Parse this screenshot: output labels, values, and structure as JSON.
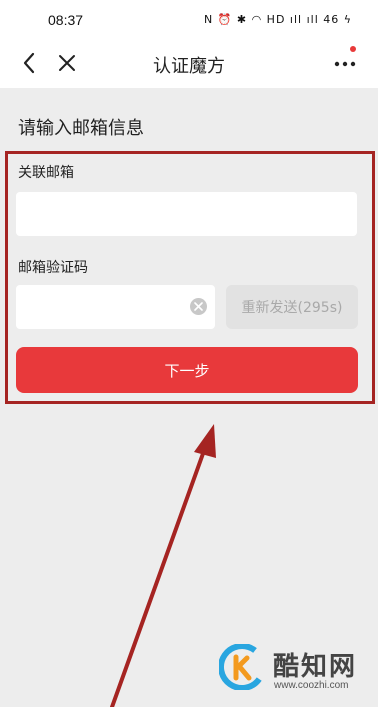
{
  "status_bar": {
    "time": "08:37",
    "icons_text": "N ⏰ ✱ ◠ HD ıll ıll 46 ϟ",
    "icons": [
      "nfc-icon",
      "alarm-icon",
      "bluetooth-icon",
      "wifi-icon",
      "hd-icon",
      "signal-icon",
      "signal-icon",
      "battery-icon",
      "charging-icon"
    ],
    "battery_level": "46"
  },
  "nav": {
    "title": "认证魔方",
    "back_icon": "back-chevron-icon",
    "close_icon": "close-icon",
    "more_icon": "more-dots-icon",
    "notification_dot_color": "#e83a3a"
  },
  "form": {
    "section_title": "请输入邮箱信息",
    "email_label": "关联邮箱",
    "email_value": "",
    "code_label": "邮箱验证码",
    "code_value": "",
    "resend_label": "重新发送(295s)",
    "next_label": "下一步"
  },
  "colors": {
    "accent": "#e8393b",
    "annotation": "#a52422",
    "background": "#ededed",
    "resend_disabled_bg": "#e2e2e2",
    "resend_disabled_text": "#a9a9a9"
  },
  "watermark": {
    "name": "酷知网",
    "url": "www.coozhi.com",
    "logo_icon": "coozhi-logo-icon"
  }
}
